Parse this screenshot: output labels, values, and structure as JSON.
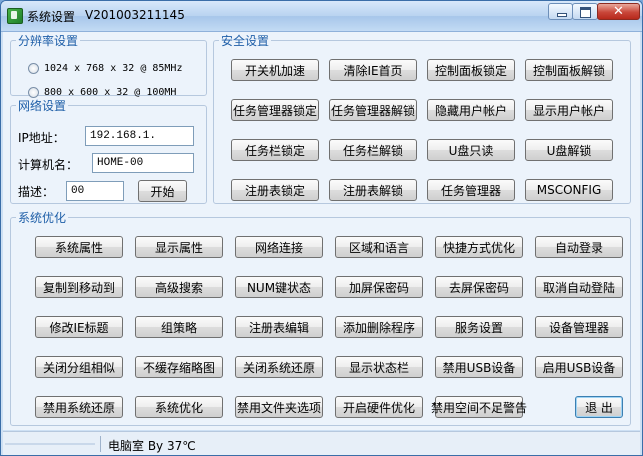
{
  "window": {
    "title": "系统设置",
    "version": "V201003211145"
  },
  "resolution": {
    "legend": "分辨率设置",
    "options": [
      {
        "label": "1024 x 768 x 32 @ 85MHz"
      },
      {
        "label": "800 x 600 x 32  @ 100MH"
      }
    ]
  },
  "network": {
    "legend": "网络设置",
    "ip_label": "IP地址：",
    "ip_value": "192.168.1.",
    "name_label": "计算机名：",
    "name_value": "HOME-00",
    "desc_label": "描述：",
    "desc_value": "00",
    "start_button": "开始"
  },
  "security": {
    "legend": "安全设置",
    "buttons": [
      "开关机加速",
      "清除IE首页",
      "控制面板锁定",
      "控制面板解锁",
      "任务管理器锁定",
      "任务管理器解锁",
      "隐藏用户帐户",
      "显示用户帐户",
      "任务栏锁定",
      "任务栏解锁",
      "U盘只读",
      "U盘解锁",
      "注册表锁定",
      "注册表解锁",
      "任务管理器",
      "MSCONFIG"
    ]
  },
  "optimize": {
    "legend": "系统优化",
    "buttons": [
      "系统属性",
      "显示属性",
      "网络连接",
      "区域和语言",
      "快捷方式优化",
      "自动登录",
      "复制到移动到",
      "高级搜索",
      "NUM键状态",
      "加屏保密码",
      "去屏保密码",
      "取消自动登陆",
      "修改IE标题",
      "组策略",
      "注册表编辑",
      "添加删除程序",
      "服务设置",
      "设备管理器",
      "关闭分组相似",
      "不缓存缩略图",
      "关闭系统还原",
      "显示状态栏",
      "禁用USB设备",
      "启用USB设备",
      "禁用系统还原",
      "系统优化",
      "禁用文件夹选项",
      "开启硬件优化",
      "禁用空间不足警告",
      "退 出"
    ]
  },
  "status": {
    "text": "电脑室 By 37℃"
  }
}
